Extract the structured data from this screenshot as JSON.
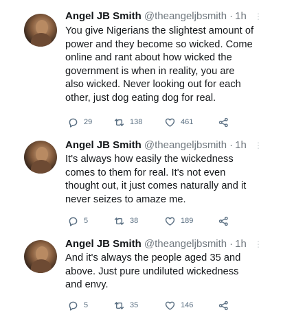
{
  "tweets": [
    {
      "name": "Angel JB Smith",
      "handle": "@theangeljbsmith",
      "time": "1h",
      "lines": [
        "You give Nigerians the slightest amount of",
        "power and they become so wicked. Come",
        "online and rant about how wicked the",
        "government is when in reality, you are",
        "also wicked. Never looking out for each",
        "other, just dog eating dog for real."
      ],
      "replies": "29",
      "retweets": "138",
      "likes": "461"
    },
    {
      "name": "Angel JB Smith",
      "handle": "@theangeljbsmith",
      "time": "1h",
      "lines": [
        "It's always how easily the wickedness",
        "comes to them for real. It's not even",
        "thought out, it just comes naturally and it",
        "never seizes to amaze me."
      ],
      "replies": "5",
      "retweets": "38",
      "likes": "189"
    },
    {
      "name": "Angel JB Smith",
      "handle": "@theangeljbsmith",
      "time": "1h",
      "lines": [
        "And it's always the people aged 35 and",
        "above. Just pure undiluted wickedness",
        "and envy."
      ],
      "replies": "5",
      "retweets": "35",
      "likes": "146"
    }
  ],
  "icons": {
    "reply": "reply-icon",
    "retweet": "retweet-icon",
    "like": "heart-icon",
    "share": "share-icon",
    "more": "more-icon"
  },
  "colors": {
    "text": "#14171a",
    "secondary": "#6e767d",
    "action": "#5b7083"
  }
}
